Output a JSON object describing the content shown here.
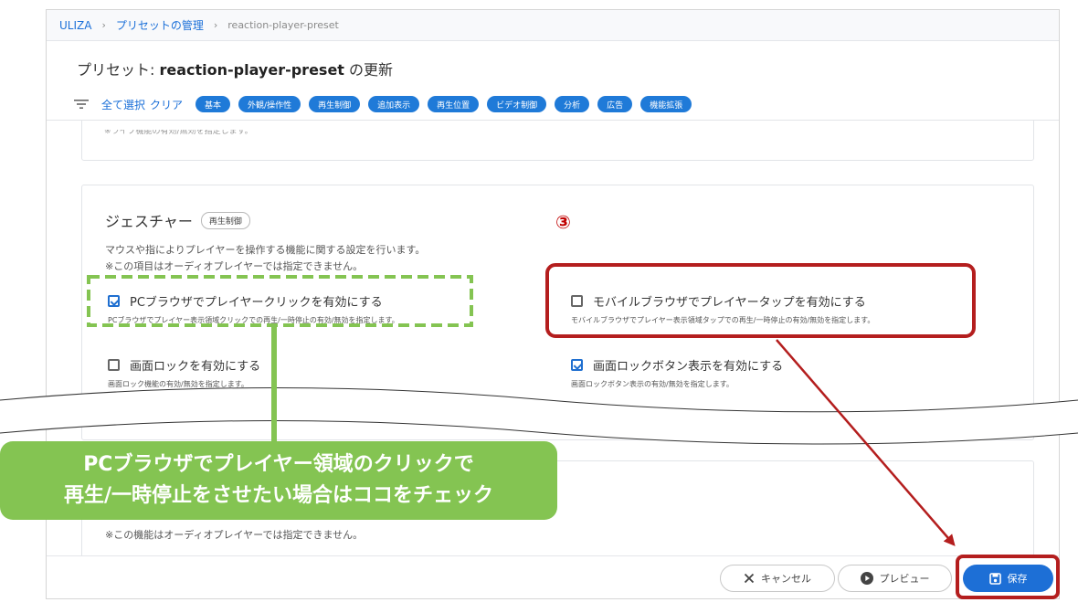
{
  "breadcrumb": {
    "root": "ULIZA",
    "parent": "プリセットの管理",
    "current": "reaction-player-preset"
  },
  "page_title": {
    "prefix": "プリセット: ",
    "name": "reaction-player-preset",
    "suffix": " の更新"
  },
  "filter": {
    "icon": "filter-list-icon",
    "select_all": "全て選択",
    "clear": "クリア",
    "chips": [
      "基本",
      "外観/操作性",
      "再生制御",
      "追加表示",
      "再生位置",
      "ビデオ制御",
      "分析",
      "広告",
      "機能拡張"
    ]
  },
  "prev_card": {
    "cut_text": "※ライブ機能の有効/無効を指定します。"
  },
  "gesture": {
    "title": "ジェスチャー",
    "badge": "再生制御",
    "desc1": "マウスや指によりプレイヤーを操作する機能に関する設定を行います。",
    "desc2": "※この項目はオーディオプレイヤーでは指定できません。",
    "options": [
      {
        "label": "PCブラウザでプレイヤークリックを有効にする",
        "desc": "PCブラウザでプレイヤー表示領域クリックでの再生/一時停止の有効/無効を指定します。",
        "checked": true
      },
      {
        "label": "モバイルブラウザでプレイヤータップを有効にする",
        "desc": "モバイルブラウザでプレイヤー表示領域タップでの再生/一時停止の有効/無効を指定します。",
        "checked": false
      },
      {
        "label": "画面ロックを有効にする",
        "desc": "画面ロック機能の有効/無効を指定します。",
        "checked": false
      },
      {
        "label": "画面ロックボタン表示を有効にする",
        "desc": "画面ロックボタン表示の有効/無効を指定します。",
        "checked": true
      }
    ]
  },
  "next_card": {
    "desc": "※この機能はオーディオプレイヤーでは指定できません。"
  },
  "footer": {
    "cancel_label": "キャンセル",
    "preview_label": "プレビュー",
    "save_label": "保存"
  },
  "annotation": {
    "number": "③",
    "callout_line1": "PCブラウザでプレイヤー領域のクリックで",
    "callout_line2": "再生/一時停止をさせたい場合はココをチェック",
    "highlight_colors": {
      "green": "#84c452",
      "red": "#b41e1e"
    }
  }
}
